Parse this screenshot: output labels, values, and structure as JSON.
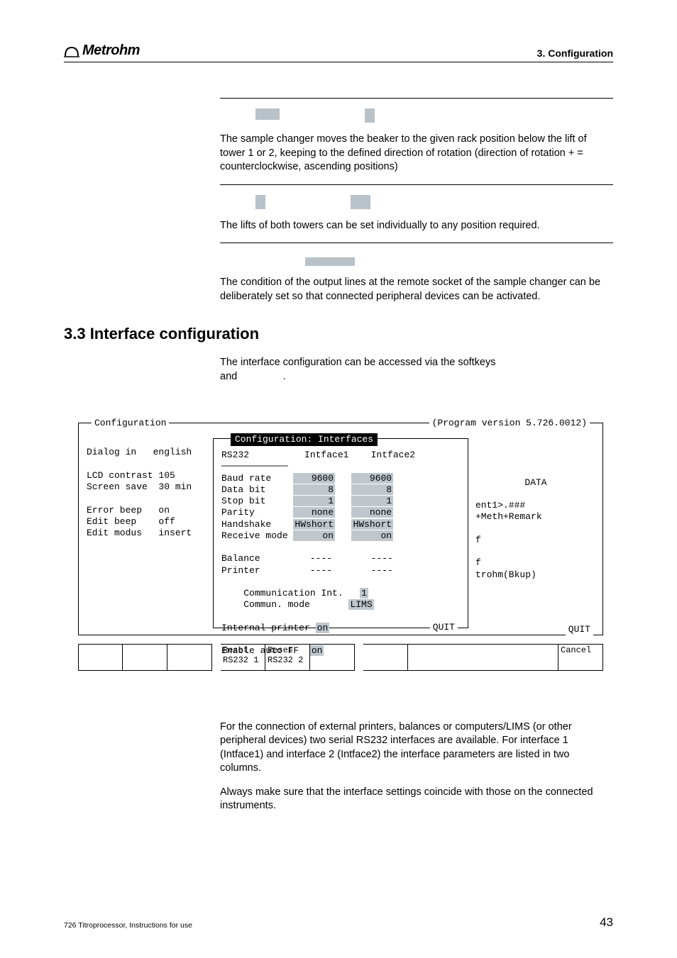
{
  "header": {
    "brand": "Metrohm",
    "section": "3. Configuration"
  },
  "content": {
    "para1": "The sample changer moves the beaker to the given rack position below the lift of tower 1 or 2, keeping to the defined direction of rotation (direction of rotation + = counterclockwise, ascending positions)",
    "para2": "The lifts of both towers can be set individually to any position required.",
    "para3": "The condition of the output lines at the remote socket of the sample changer can be deliberately set so that connected peripheral devices can be activated.",
    "h2": "3.3  Interface configuration",
    "intro1": "The interface configuration can be accessed via the softkeys",
    "intro2": "and",
    "body2a": "For the connection of external printers, balances or computers/LIMS (or other peripheral devices) two serial RS232 interfaces are available. For interface 1 (Intface1) and interface 2 (Intface2) the interface parameters are listed in two columns.",
    "body2b": "Always make sure that the interface settings coincide with those on the connected instruments."
  },
  "config_screen": {
    "outer_title": "Configuration",
    "version": "(Program version 5.726.0012)",
    "left": {
      "dialog_label": "Dialog in",
      "dialog_val": "english",
      "rows": [
        [
          "LCD contrast",
          "105"
        ],
        [
          "Screen save",
          "30 min"
        ],
        [
          "",
          ""
        ],
        [
          "Error beep",
          "on"
        ],
        [
          "Edit beep",
          "off"
        ],
        [
          "Edit modus",
          "insert"
        ]
      ]
    },
    "inner_title": "Configuration: Interfaces",
    "rs232": {
      "header": [
        "RS232",
        "Intface1",
        "Intface2"
      ],
      "rows": [
        [
          "Baud rate",
          "9600",
          "9600"
        ],
        [
          "Data bit",
          "8",
          "8"
        ],
        [
          "Stop bit",
          "1",
          "1"
        ],
        [
          "Parity",
          "none",
          "none"
        ],
        [
          "Handshake",
          "HWshort",
          "HWshort"
        ],
        [
          "Receive mode",
          "on",
          "on"
        ]
      ],
      "balance": [
        "Balance",
        "----",
        "----"
      ],
      "printer": [
        "Printer",
        "----",
        "----"
      ],
      "comm_int": [
        "Communication Int.",
        "1"
      ],
      "comm_mode": [
        "Commun. mode",
        "LIMS"
      ],
      "int_printer": [
        "Internal printer",
        "on"
      ],
      "auto_ff": [
        "Enable auto FF",
        "on"
      ],
      "quit": "QUIT"
    },
    "right": {
      "title": "DATA",
      "lines": [
        "ent1>.###",
        "+Meth+Remark",
        "",
        "f",
        "",
        "f",
        "trohm(Bkup)"
      ],
      "quit": "QUIT"
    },
    "softkeys": [
      "",
      "",
      "",
      "Reset\nRS232 1",
      "Reset\nRS232 2",
      "",
      "",
      "",
      "Cancel"
    ]
  },
  "footer": {
    "left": "726 Titroprocessor, Instructions for use",
    "page": "43"
  }
}
